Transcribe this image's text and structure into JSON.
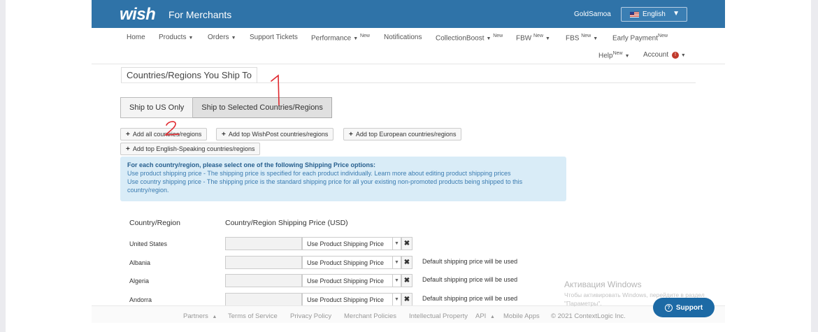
{
  "header": {
    "logo": "wish",
    "subtitle": "For Merchants",
    "username": "GoldSamoa",
    "language": "English"
  },
  "nav": {
    "home": "Home",
    "products": "Products",
    "orders": "Orders",
    "support_tickets": "Support Tickets",
    "performance": "Performance",
    "notifications": "Notifications",
    "collection_boost": "CollectionBoost",
    "fbw": "FBW",
    "fbs": "FBS",
    "early_payment": "Early Payment",
    "help": "Help",
    "account": "Account",
    "new_tag": "New",
    "account_badge": "!"
  },
  "page": {
    "section_title": "Countries/Regions You Ship To",
    "ship_us_only": "Ship to US Only",
    "ship_selected": "Ship to Selected Countries/Regions",
    "add_all": "Add all countries/regions",
    "add_wishpost": "Add top WishPost countries/regions",
    "add_european": "Add top European countries/regions",
    "add_english": "Add top English-Speaking countries/regions"
  },
  "info": {
    "heading": "For each country/region, please select one of the following Shipping Price options:",
    "line1": "Use product shipping price - The shipping price is specified for each product individually.",
    "line1_link": "Learn more about editing product shipping prices",
    "line2": "Use country shipping price - The shipping price is the standard shipping price for all your existing non-promoted products being shipped to this country/region."
  },
  "table": {
    "col_country": "Country/Region",
    "col_price": "Country/Region Shipping Price (USD)",
    "rows": [
      {
        "country": "United States",
        "option": "Use Product Shipping Price",
        "note": ""
      },
      {
        "country": "Albania",
        "option": "Use Product Shipping Price",
        "note": "Default shipping price will be used"
      },
      {
        "country": "Algeria",
        "option": "Use Product Shipping Price",
        "note": "Default shipping price will be used"
      },
      {
        "country": "Andorra",
        "option": "Use Product Shipping Price",
        "note": "Default shipping price will be used"
      }
    ]
  },
  "footer": {
    "partners": "Partners",
    "terms": "Terms of Service",
    "privacy": "Privacy Policy",
    "merchant_policies": "Merchant Policies",
    "ip": "Intellectual Property",
    "api": "API",
    "mobile_apps": "Mobile Apps",
    "copyright": "© 2021 ContextLogic Inc."
  },
  "overlay": {
    "activation_title": "Активация Windows",
    "activation_sub": "Чтобы активировать Windows, перейдите в раздел \"Параметры\".",
    "support": "Support",
    "annotation_1": "1",
    "annotation_2": "2"
  },
  "colors": {
    "header_blue": "#2f73a8",
    "info_bg": "#d9ecf7",
    "support_blue": "#1d6aa5",
    "annotation_red": "#e0282e"
  }
}
